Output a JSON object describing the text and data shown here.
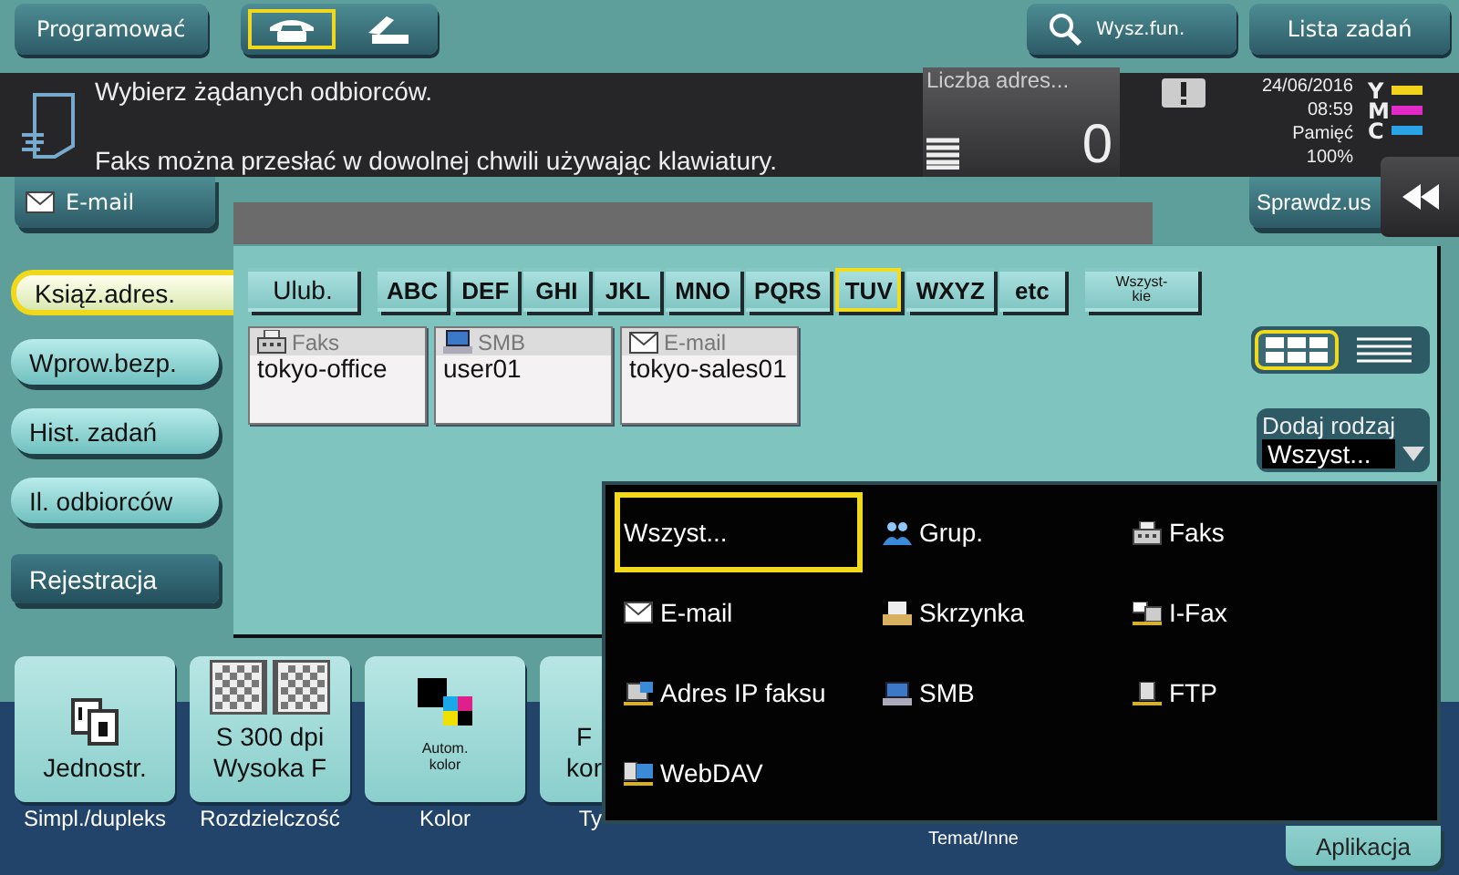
{
  "top_bar": {
    "program_button": "Programować",
    "mode_tabs": [
      {
        "kind": "phone",
        "selected": true
      },
      {
        "kind": "handset",
        "selected": false
      }
    ],
    "search_button": "Wysz.fun.",
    "job_list_button": "Lista zadań"
  },
  "message": {
    "lines": [
      "Wybierz żądanych odbiorców.",
      "Faks można przesłać w dowolnej chwili używając klawiatury."
    ],
    "counter": {
      "label": "Liczba adres...",
      "value": "0"
    },
    "date": "24/06/2016",
    "time": "08:59",
    "memory_label": "Pamięć",
    "memory_value": "100%",
    "toner": [
      {
        "label": "Y",
        "color": "#f2d21a"
      },
      {
        "label": "M",
        "color": "#e22ac8"
      },
      {
        "label": "C",
        "color": "#2aa4e6"
      }
    ]
  },
  "email_tab": "E-mail",
  "check_button": "Sprawdz.us",
  "side_tabs": [
    {
      "label": "Książ.adres.",
      "kind": "tab",
      "selected": true
    },
    {
      "label": "Wprow.bezp.",
      "kind": "tab",
      "selected": false
    },
    {
      "label": "Hist. zadań",
      "kind": "tab",
      "selected": false
    },
    {
      "label": "Il. odbiorców",
      "kind": "tab",
      "selected": false
    },
    {
      "label": "Rejestracja",
      "kind": "action",
      "selected": false
    }
  ],
  "index_tabs": [
    {
      "label": "Ulub.",
      "kind": "wide",
      "selected": false
    },
    {
      "label": "ABC",
      "kind": "letters",
      "selected": false
    },
    {
      "label": "DEF",
      "kind": "letters",
      "selected": false
    },
    {
      "label": "GHI",
      "kind": "letters",
      "selected": false
    },
    {
      "label": "JKL",
      "kind": "letters",
      "selected": false
    },
    {
      "label": "MNO",
      "kind": "letters",
      "selected": false
    },
    {
      "label": "PQRS",
      "kind": "letters",
      "selected": false
    },
    {
      "label": "TUV",
      "kind": "letters",
      "selected": true
    },
    {
      "label": "WXYZ",
      "kind": "letters",
      "selected": false
    },
    {
      "label": "etc",
      "kind": "letters",
      "selected": false
    },
    {
      "label": "Wszyst-kie",
      "kind": "small",
      "selected": false
    }
  ],
  "addresses": [
    {
      "kind": "fax",
      "type": "Faks",
      "name": "tokyo-office"
    },
    {
      "kind": "smb",
      "type": "SMB",
      "name": "user01"
    },
    {
      "kind": "email",
      "type": "E-mail",
      "name": "tokyo-sales01"
    }
  ],
  "view_toggle": [
    {
      "kind": "thumbnail",
      "selected": true
    },
    {
      "kind": "list",
      "selected": false
    }
  ],
  "type_filter": {
    "label": "Dodaj rodzaj",
    "value": "Wszyst..."
  },
  "type_menu": [
    {
      "kind": "all",
      "label": "Wszyst...",
      "selected": true
    },
    {
      "kind": "group",
      "label": "Grup.",
      "selected": false
    },
    {
      "kind": "fax",
      "label": "Faks",
      "selected": false
    },
    {
      "kind": "email",
      "label": "E-mail",
      "selected": false
    },
    {
      "kind": "box",
      "label": "Skrzynka",
      "selected": false
    },
    {
      "kind": "ifax",
      "label": "I-Fax",
      "selected": false
    },
    {
      "kind": "ipfax",
      "label": "Adres IP faksu",
      "selected": false
    },
    {
      "kind": "smb",
      "label": "SMB",
      "selected": false
    },
    {
      "kind": "ftp",
      "label": "FTP",
      "selected": false
    },
    {
      "kind": "webdav",
      "label": "WebDAV",
      "selected": false
    }
  ],
  "settings": [
    {
      "kind": "duplex",
      "lines": [
        "Jednostr."
      ],
      "label": "Simpl./dupleks"
    },
    {
      "kind": "resolution",
      "lines": [
        "S 300 dpi",
        "Wysoka F"
      ],
      "label": "Rozdzielczość"
    },
    {
      "kind": "color",
      "lines": [
        "Autom.",
        "kolor"
      ],
      "label": "Kolor"
    },
    {
      "kind": "cut",
      "lines": [
        "F",
        "kor"
      ],
      "label": "Ty"
    }
  ],
  "subject_label": "Temat/Inne",
  "app_button": "Aplikacja"
}
